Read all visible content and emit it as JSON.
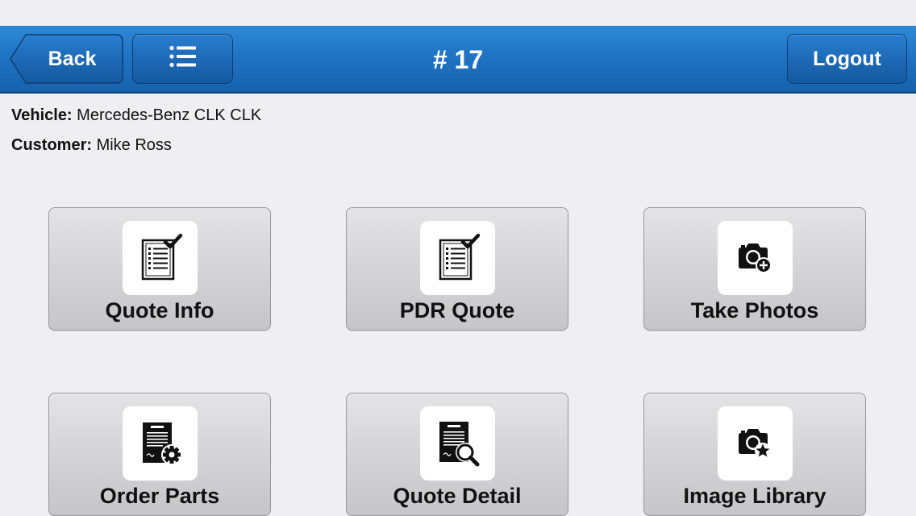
{
  "header": {
    "back_label": "Back",
    "title": "# 17",
    "logout_label": "Logout",
    "menu_icon": "list-icon"
  },
  "info": {
    "vehicle_label": "Vehicle:",
    "vehicle_value": "Mercedes-Benz CLK CLK",
    "customer_label": "Customer:",
    "customer_value": "Mike Ross"
  },
  "tiles": [
    {
      "label": "Quote Info",
      "icon": "checklist-icon"
    },
    {
      "label": "PDR Quote",
      "icon": "checklist-icon"
    },
    {
      "label": "Take Photos",
      "icon": "camera-add-icon"
    },
    {
      "label": "Order Parts",
      "icon": "document-gear-icon"
    },
    {
      "label": "Quote Detail",
      "icon": "document-search-icon"
    },
    {
      "label": "Image Library",
      "icon": "camera-star-icon"
    }
  ],
  "colors": {
    "header_blue": "#1f74c3",
    "header_border": "#0f3f73",
    "background": "#efeff1",
    "tile_gray": "#d4d4d7"
  }
}
